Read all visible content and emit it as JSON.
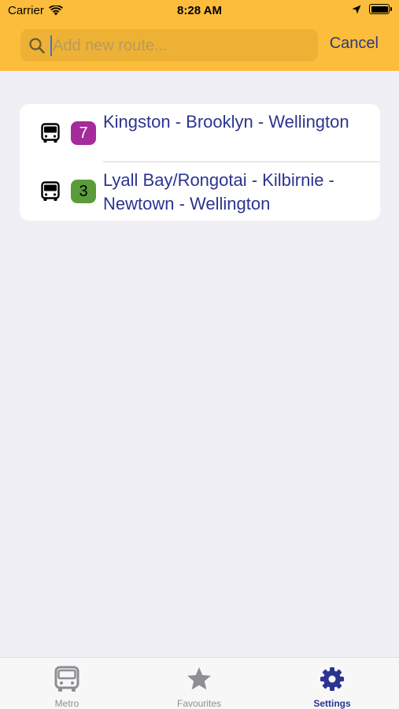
{
  "status_bar": {
    "carrier": "Carrier",
    "time": "8:28 AM"
  },
  "search": {
    "placeholder": "Add new route...",
    "value": "",
    "cancel_label": "Cancel"
  },
  "routes": [
    {
      "number": "7",
      "name": "Kingston - Brooklyn - Wellington",
      "badge_color": "#a52a9c",
      "icon": "bus-icon"
    },
    {
      "number": "3",
      "name": "Lyall Bay/Rongotai - Kilbirnie - Newtown - Wellington",
      "badge_color": "#5a9b3a",
      "icon": "bus-icon"
    }
  ],
  "tabs": [
    {
      "label": "Metro",
      "icon": "bus-icon",
      "active": false
    },
    {
      "label": "Favourites",
      "icon": "star-icon",
      "active": false
    },
    {
      "label": "Settings",
      "icon": "gear-icon",
      "active": true
    }
  ],
  "colors": {
    "header": "#fbbd3b",
    "accent": "#2b3590",
    "background": "#f0eff5"
  }
}
